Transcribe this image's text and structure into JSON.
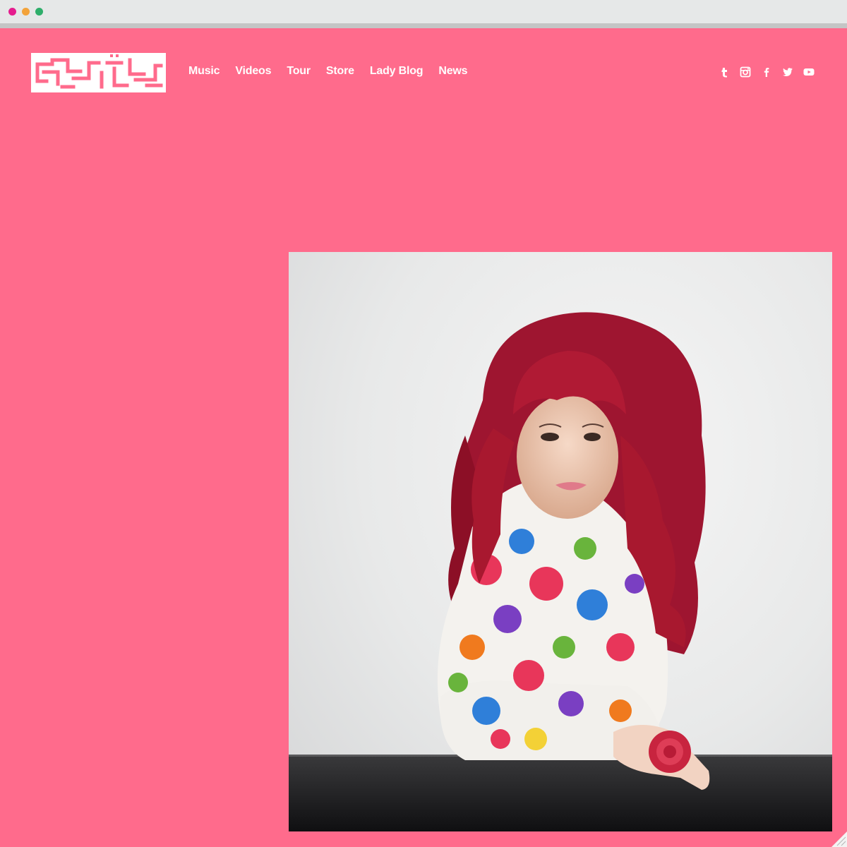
{
  "browser": {
    "window_controls": [
      "close-dot",
      "minimize-dot",
      "maximize-dot"
    ],
    "colors": {
      "close": "#e51d8e",
      "minimize": "#f3a33a",
      "maximize": "#2eae6a"
    }
  },
  "site": {
    "background_color": "#ff6b8c",
    "logo": {
      "name": "site-logo",
      "color": "#ffffff"
    },
    "nav": [
      {
        "label": "Music"
      },
      {
        "label": "Videos"
      },
      {
        "label": "Tour"
      },
      {
        "label": "Store"
      },
      {
        "label": "Lady Blog"
      },
      {
        "label": "News"
      }
    ],
    "social_icons": [
      "tumblr-icon",
      "instagram-icon",
      "facebook-icon",
      "twitter-icon",
      "youtube-icon"
    ]
  },
  "hero": {
    "image": "portrait-photo",
    "description_icon": "photo-image"
  }
}
